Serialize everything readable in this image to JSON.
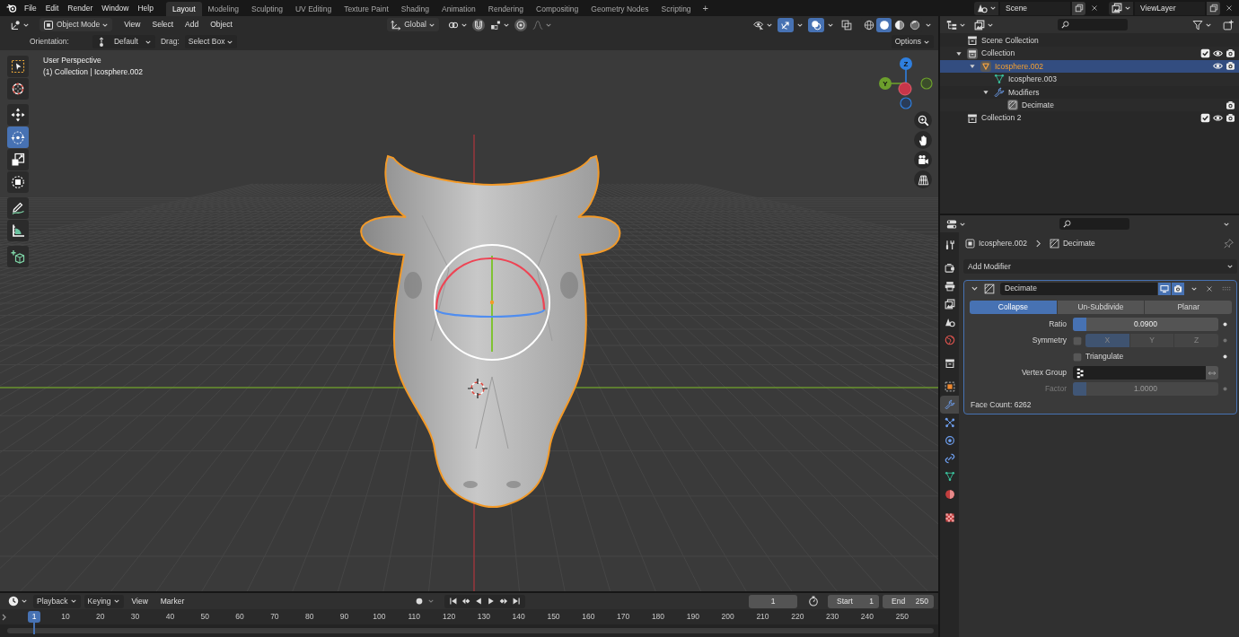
{
  "top_bar": {
    "menus": [
      "File",
      "Edit",
      "Render",
      "Window",
      "Help"
    ],
    "workspaces": [
      {
        "label": "Layout",
        "selected": true
      },
      {
        "label": "Modeling",
        "selected": false
      },
      {
        "label": "Sculpting",
        "selected": false
      },
      {
        "label": "UV Editing",
        "selected": false
      },
      {
        "label": "Texture Paint",
        "selected": false
      },
      {
        "label": "Shading",
        "selected": false
      },
      {
        "label": "Animation",
        "selected": false
      },
      {
        "label": "Rendering",
        "selected": false
      },
      {
        "label": "Compositing",
        "selected": false
      },
      {
        "label": "Geometry Nodes",
        "selected": false
      },
      {
        "label": "Scripting",
        "selected": false
      }
    ],
    "add_workspace": "+",
    "scene": "Scene",
    "view_layer": "ViewLayer"
  },
  "viewport": {
    "mode": "Object Mode",
    "menus": [
      "View",
      "Select",
      "Add",
      "Object"
    ],
    "transform_orientation": "Global",
    "viewport_toggles": [
      {
        "kind": "gizmos",
        "on": true
      },
      {
        "kind": "overlays",
        "on": true
      },
      {
        "kind": "xray",
        "on": false
      }
    ],
    "shading_modes": [
      {
        "kind": "wireframe",
        "selected": false
      },
      {
        "kind": "solid",
        "selected": true
      },
      {
        "kind": "material",
        "selected": false
      },
      {
        "kind": "rendered",
        "selected": false
      }
    ],
    "tool_settings": {
      "orientation_label": "Orientation:",
      "orientation": "Default",
      "drag_label": "Drag:",
      "drag": "Select Box",
      "options": "Options"
    },
    "tool_groups": [
      [
        {
          "kind": "selectbox",
          "selected": false
        },
        {
          "kind": "cursor",
          "selected": false
        }
      ],
      [
        {
          "kind": "move",
          "selected": false
        },
        {
          "kind": "rotate",
          "selected": true
        },
        {
          "kind": "scale",
          "selected": false
        },
        {
          "kind": "transform",
          "selected": false
        }
      ],
      [
        {
          "kind": "annotate",
          "selected": false
        },
        {
          "kind": "measure",
          "selected": false
        }
      ],
      [
        {
          "kind": "addcube",
          "selected": false
        }
      ]
    ],
    "info": [
      "User Perspective",
      "(1) Collection | Icosphere.002"
    ],
    "nav_axes": [
      {
        "label": "Z",
        "color": "#2f7fdf"
      },
      {
        "label": "Y",
        "color": "#6c9f2c"
      }
    ]
  },
  "outliner": {
    "tree": [
      {
        "label": "Scene Collection",
        "kind": "scenecollection",
        "selected": false,
        "active": false,
        "children": [
          {
            "label": "Collection",
            "kind": "collection",
            "selected": false,
            "active": true,
            "expanded": true,
            "checked": true,
            "visible": true,
            "renderable": true,
            "children": [
              {
                "label": "Icosphere.002",
                "kind": "object",
                "selected": true,
                "active": true,
                "expanded": true,
                "visible": true,
                "renderable": true,
                "children": [
                  {
                    "label": "Icosphere.003",
                    "kind": "mesh",
                    "selected": false,
                    "active": false
                  },
                  {
                    "label": "Modifiers",
                    "kind": "modifiers",
                    "selected": false,
                    "active": false,
                    "expanded": true,
                    "children": [
                      {
                        "label": "Decimate",
                        "kind": "modifier",
                        "selected": false,
                        "active": true,
                        "renderable": true
                      }
                    ]
                  }
                ]
              }
            ]
          },
          {
            "label": "Collection 2",
            "kind": "collection",
            "selected": false,
            "active": false,
            "checked": true,
            "visible": true,
            "renderable": true
          }
        ]
      }
    ]
  },
  "properties": {
    "tab_groups": [
      [
        {
          "kind": "tool",
          "selected": false
        }
      ],
      [
        {
          "kind": "render",
          "selected": false
        },
        {
          "kind": "output",
          "selected": false
        },
        {
          "kind": "viewlayer",
          "selected": false
        },
        {
          "kind": "scene",
          "selected": false
        },
        {
          "kind": "world",
          "selected": false
        }
      ],
      [
        {
          "kind": "collection",
          "selected": false
        }
      ],
      [
        {
          "kind": "object",
          "selected": false
        },
        {
          "kind": "modifiers",
          "selected": true
        },
        {
          "kind": "particles",
          "selected": false
        },
        {
          "kind": "physics",
          "selected": false
        },
        {
          "kind": "constraints",
          "selected": false
        },
        {
          "kind": "data",
          "selected": false
        },
        {
          "kind": "material",
          "selected": false
        }
      ],
      [
        {
          "kind": "texture",
          "selected": false
        }
      ]
    ],
    "breadcrumb": [
      {
        "kind": "object",
        "label": "Icosphere.002"
      },
      {
        "kind": "modifier",
        "label": "Decimate"
      }
    ],
    "add_modifier": "Add Modifier",
    "modifier": {
      "name": "Decimate",
      "expanded": true,
      "show_in_viewport": true,
      "show_in_render": true,
      "modes": [
        {
          "label": "Collapse",
          "selected": true
        },
        {
          "label": "Un-Subdivide",
          "selected": false
        },
        {
          "label": "Planar",
          "selected": false
        }
      ],
      "fields": [
        {
          "kind": "slider",
          "label": "Ratio",
          "value": "0.0900",
          "level": 0.09,
          "disabled": false
        },
        {
          "kind": "axes",
          "label": "Symmetry",
          "checked": false,
          "disabled": false,
          "axes": [
            {
              "label": "X",
              "selected": true
            },
            {
              "label": "Y",
              "selected": false
            },
            {
              "label": "Z",
              "selected": false
            }
          ]
        },
        {
          "kind": "checkbox",
          "label": "Triangulate",
          "checked": false,
          "disabled": false
        },
        {
          "kind": "vertexgroup",
          "label": "Vertex Group",
          "disabled": false
        },
        {
          "kind": "slider",
          "label": "Factor",
          "value": "1.0000",
          "level": 0.09,
          "disabled": true
        }
      ],
      "face_count": "Face Count: 6262"
    }
  },
  "timeline": {
    "menus": [
      {
        "label": "Playback",
        "kind": "dropdown"
      },
      {
        "label": "Keying",
        "kind": "dropdown"
      },
      {
        "label": "View",
        "kind": "menu"
      },
      {
        "label": "Marker",
        "kind": "menu"
      }
    ],
    "current_frame": "1",
    "start_label": "Start",
    "start": "1",
    "end_label": "End",
    "end": "250",
    "playhead": "1",
    "frame_labels": [
      "10",
      "20",
      "30",
      "40",
      "50",
      "60",
      "70",
      "80",
      "90",
      "100",
      "110",
      "120",
      "130",
      "140",
      "150",
      "160",
      "170",
      "180",
      "190",
      "200",
      "210",
      "220",
      "230",
      "240",
      "250"
    ]
  }
}
